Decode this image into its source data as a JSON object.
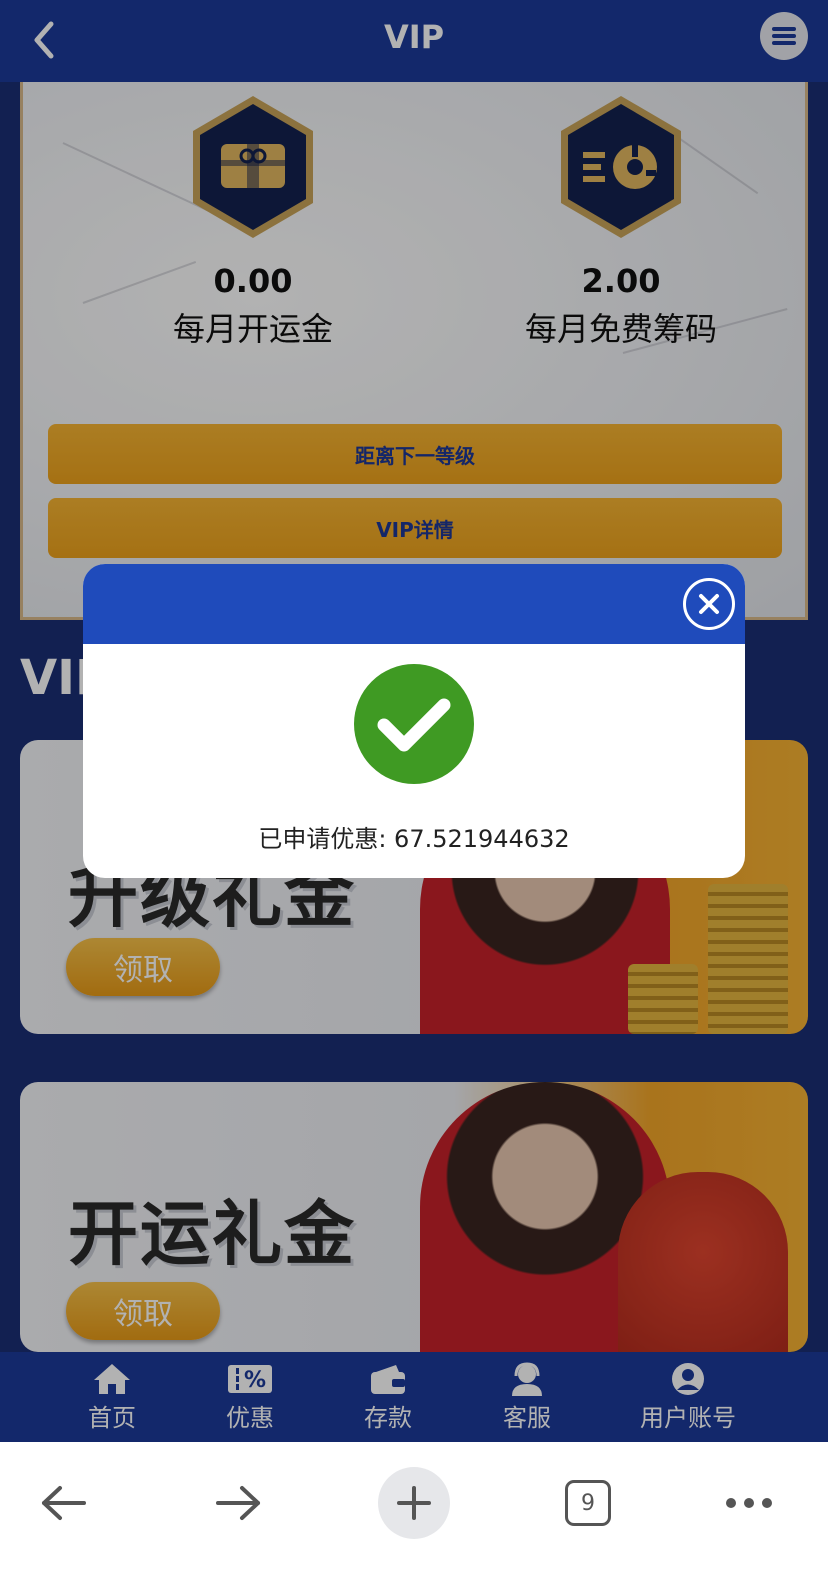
{
  "header": {
    "title": "VIP",
    "back_icon": "chevron-left-icon",
    "menu_icon": "hamburger-menu-icon"
  },
  "benefits": [
    {
      "value": "0.00",
      "label": "每月开运金",
      "icon": "gift-card-icon"
    },
    {
      "value": "2.00",
      "label": "每月免费筹码",
      "icon": "chip-icon"
    }
  ],
  "buttons": {
    "next_level": "距离下一等级",
    "vip_details": "VIP详情"
  },
  "section": {
    "title": "VIP"
  },
  "promotions": [
    {
      "title": "升级礼金",
      "claim_label": "领取"
    },
    {
      "title": "开运礼金",
      "claim_label": "领取"
    }
  ],
  "modal": {
    "close_icon": "close-x-icon",
    "status_icon": "check-circle-icon",
    "message": "已申请优惠: 67.521944632"
  },
  "bottom_nav": [
    {
      "label": "首页",
      "icon": "home-icon"
    },
    {
      "label": "优惠",
      "icon": "percent-ticket-icon"
    },
    {
      "label": "存款",
      "icon": "wallet-icon"
    },
    {
      "label": "客服",
      "icon": "headset-agent-icon"
    },
    {
      "label": "用户账号",
      "icon": "user-icon"
    }
  ],
  "browser": {
    "tab_count": "9",
    "back_icon": "arrow-left-icon",
    "forward_icon": "arrow-right-icon",
    "new_tab_icon": "plus-icon",
    "more_icon": "more-dots-icon"
  },
  "colors": {
    "header_blue": "#1c3a9a",
    "modal_header_blue": "#1f4bbb",
    "gold": "#f1a825",
    "success_green": "#3f9a23"
  }
}
